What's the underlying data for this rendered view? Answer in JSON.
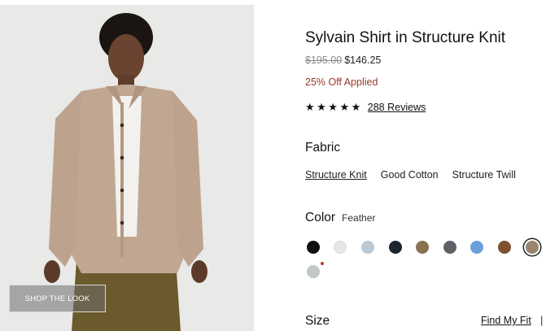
{
  "product": {
    "title": "Sylvain Shirt in Structure Knit",
    "price_original": "$195.00",
    "price_sale": "$146.25",
    "discount_text": "25% Off Applied",
    "rating_stars": "★★★★★",
    "rating_value": 5,
    "reviews_label": "288 Reviews"
  },
  "image": {
    "shop_the_look_label": "SHOP THE LOOK"
  },
  "fabric": {
    "label": "Fabric",
    "options": [
      "Structure Knit",
      "Good Cotton",
      "Structure Twill"
    ],
    "selected": "Structure Knit"
  },
  "color": {
    "label": "Color",
    "selected_name": "Feather",
    "swatches": [
      {
        "hex": "#111111"
      },
      {
        "hex": "#e6e6e6"
      },
      {
        "hex": "#b9c9d6"
      },
      {
        "hex": "#1c2630"
      },
      {
        "hex": "#8a7250"
      },
      {
        "hex": "#5d6166"
      },
      {
        "hex": "#6b9fdb"
      },
      {
        "hex": "#7e5030"
      },
      {
        "hex": "#9a8470",
        "selected": true
      },
      {
        "hex": "#c2c8c8",
        "has_indicator": true
      }
    ]
  },
  "size": {
    "label": "Size",
    "find_fit_label": "Find My Fit",
    "separator": "|"
  }
}
